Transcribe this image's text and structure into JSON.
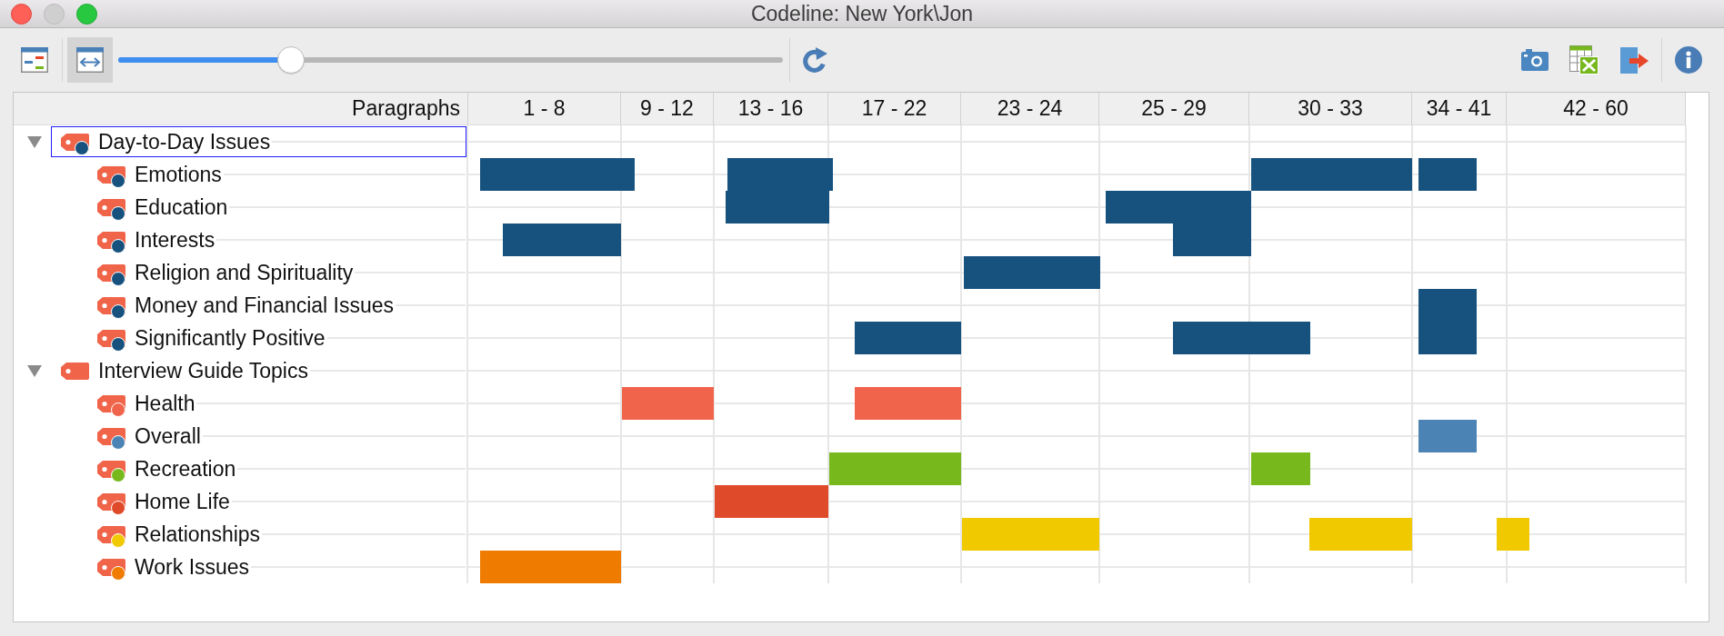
{
  "window": {
    "title": "Codeline: New York\\Jon",
    "controls": [
      {
        "disabled": false
      },
      {
        "disabled": true
      },
      {
        "disabled": false
      }
    ]
  },
  "toolbar": {
    "view_buttons": [
      {
        "selected": false
      },
      {
        "selected": true
      }
    ],
    "zoom_slider": {
      "level": 0.26
    }
  },
  "codeline": {
    "header": "Paragraphs",
    "columns": [
      "1 - 8",
      "9 - 12",
      "13 - 16",
      "17 - 22",
      "23 - 24",
      "25 - 29",
      "30 - 33",
      "34 - 41",
      "42 - 60"
    ],
    "codes": [
      {
        "label": "Day-to-Day Issues",
        "color": "#17527f",
        "expanded": true,
        "selected": true,
        "children": [
          {
            "label": "Emotions",
            "color": "#17527f",
            "selected": false
          },
          {
            "label": "Education",
            "color": "#17527f",
            "selected": false
          },
          {
            "label": "Interests",
            "color": "#17527f",
            "selected": false
          },
          {
            "label": "Religion and Spirituality",
            "color": "#17527f",
            "selected": false
          },
          {
            "label": "Money and Financial Issues",
            "color": "#17527f",
            "selected": false
          },
          {
            "label": "Significantly Positive",
            "color": "#17527f",
            "selected": false
          }
        ]
      },
      {
        "label": "Interview Guide Topics",
        "expanded": true,
        "selected": false,
        "children": [
          {
            "label": "Health",
            "color": "#f0644c",
            "selected": false
          },
          {
            "label": "Overall",
            "color": "#4b84b4",
            "selected": false
          },
          {
            "label": "Recreation",
            "color": "#77b91d",
            "selected": false
          },
          {
            "label": "Home Life",
            "color": "#df4a2a",
            "selected": false
          },
          {
            "label": "Relationships",
            "color": "#f0c900",
            "selected": false
          },
          {
            "label": "Work Issues",
            "color": "#ef7b00",
            "selected": false
          }
        ]
      }
    ]
  }
}
